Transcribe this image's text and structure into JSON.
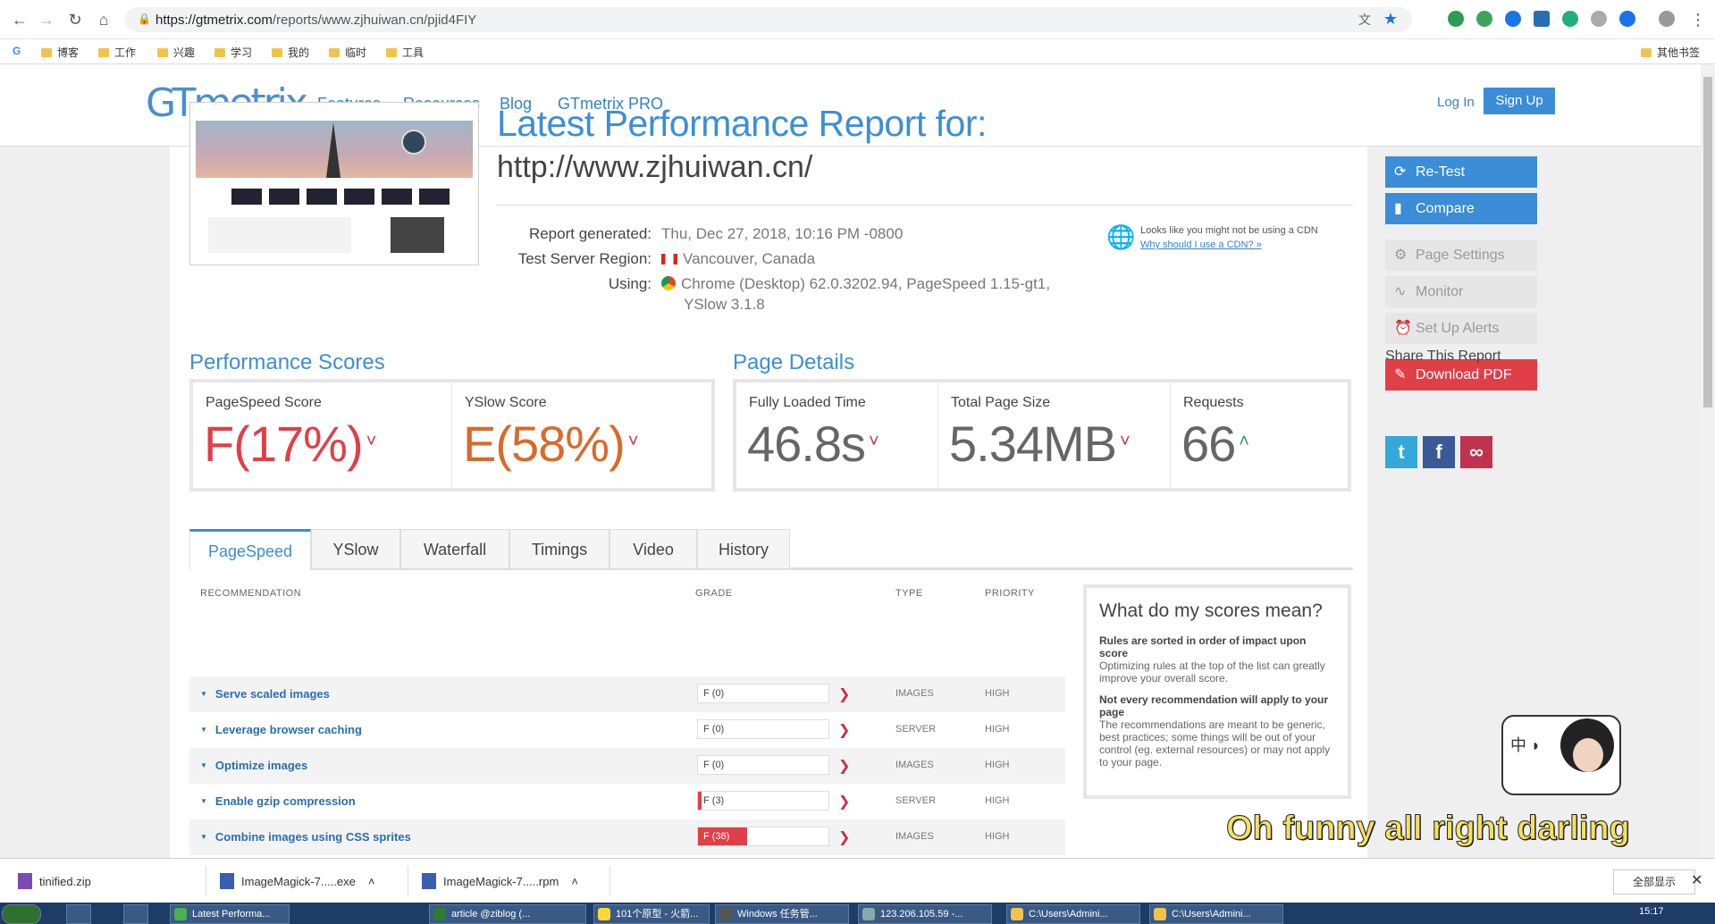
{
  "browser": {
    "url_prefix": "https://gtmetrix.com",
    "url_rest": "/reports/www.zjhuiwan.cn/pjid4FIY",
    "bookmarks": [
      "博客",
      "工作",
      "兴趣",
      "学习",
      "我的",
      "临时",
      "工具"
    ],
    "other_bookmarks": "其他书签"
  },
  "header": {
    "logo": "GTmetrix",
    "nav": [
      "Features",
      "Resources",
      "Blog",
      "GTmetrix PRO"
    ],
    "login": "Log In",
    "signup": "Sign Up"
  },
  "report": {
    "title": "Latest Performance Report for:",
    "url": "http://www.zjhuiwan.cn/",
    "generated_label": "Report generated:",
    "generated": "Thu, Dec 27, 2018, 10:16 PM -0800",
    "region_label": "Test Server Region:",
    "region": "Vancouver, Canada",
    "using_label": "Using:",
    "using_line1": "Chrome (Desktop) 62.0.3202.94, PageSpeed 1.15-gt1,",
    "using_line2": "YSlow 3.1.8",
    "cdn_text": "Looks like you might not be using a CDN",
    "cdn_link": "Why should I use a CDN? »"
  },
  "perf": {
    "heading": "Performance Scores",
    "pagespeed_label": "PageSpeed Score",
    "pagespeed_value": "F(17%)",
    "yslow_label": "YSlow Score",
    "yslow_value": "E(58%)"
  },
  "details": {
    "heading": "Page Details",
    "loaded_label": "Fully Loaded Time",
    "loaded_value": "46.8s",
    "size_label": "Total Page Size",
    "size_value": "5.34MB",
    "req_label": "Requests",
    "req_value": "66"
  },
  "tabs": [
    "PageSpeed",
    "YSlow",
    "Waterfall",
    "Timings",
    "Video",
    "History"
  ],
  "table": {
    "headers": [
      "RECOMMENDATION",
      "GRADE",
      "TYPE",
      "PRIORITY"
    ],
    "rows": [
      {
        "title": "Serve scaled images",
        "grade": "F (0)",
        "score": 0,
        "type": "IMAGES",
        "priority": "HIGH"
      },
      {
        "title": "Leverage browser caching",
        "grade": "F (0)",
        "score": 0,
        "type": "SERVER",
        "priority": "HIGH"
      },
      {
        "title": "Optimize images",
        "grade": "F (0)",
        "score": 0,
        "type": "IMAGES",
        "priority": "HIGH"
      },
      {
        "title": "Enable gzip compression",
        "grade": "F (3)",
        "score": 3,
        "type": "SERVER",
        "priority": "HIGH"
      },
      {
        "title": "Combine images using CSS sprites",
        "grade": "F (38)",
        "score": 38,
        "type": "IMAGES",
        "priority": "HIGH"
      }
    ]
  },
  "scores_box": {
    "title": "What do my scores mean?",
    "b1": "Rules are sorted in order of impact upon score",
    "t1": "Optimizing rules at the top of the list can greatly improve your overall score.",
    "b2": "Not every recommendation will apply to your page",
    "t2": "The recommendations are meant to be generic, best practices; some things will be out of your control (eg. external resources) or may not apply to your page."
  },
  "sidebar": {
    "retest": "Re-Test",
    "compare": "Compare",
    "page_settings": "Page Settings",
    "monitor": "Monitor",
    "alerts": "Set Up Alerts",
    "pdf": "Download PDF",
    "share": "Share This Report"
  },
  "overlay": {
    "char_text": "中 ◗",
    "subtitle": "Oh funny all right darling"
  },
  "downloads": {
    "items": [
      "tinified.zip",
      "ImageMagick-7.....exe",
      "ImageMagick-7.....rpm"
    ],
    "show_all": "全部显示"
  },
  "taskbar": {
    "items": [
      "Latest Performa...",
      "article @ziblog (...",
      "101个原型 - 火箭...",
      "Windows 任务管...",
      "123.206.105.59 -...",
      "C:\\Users\\Admini...",
      "C:\\Users\\Admini..."
    ],
    "time": "15:17"
  },
  "colors": {
    "accent": "#3a8dd6",
    "grade_f": "#e03f47",
    "grade_e": "#d86a2a"
  }
}
